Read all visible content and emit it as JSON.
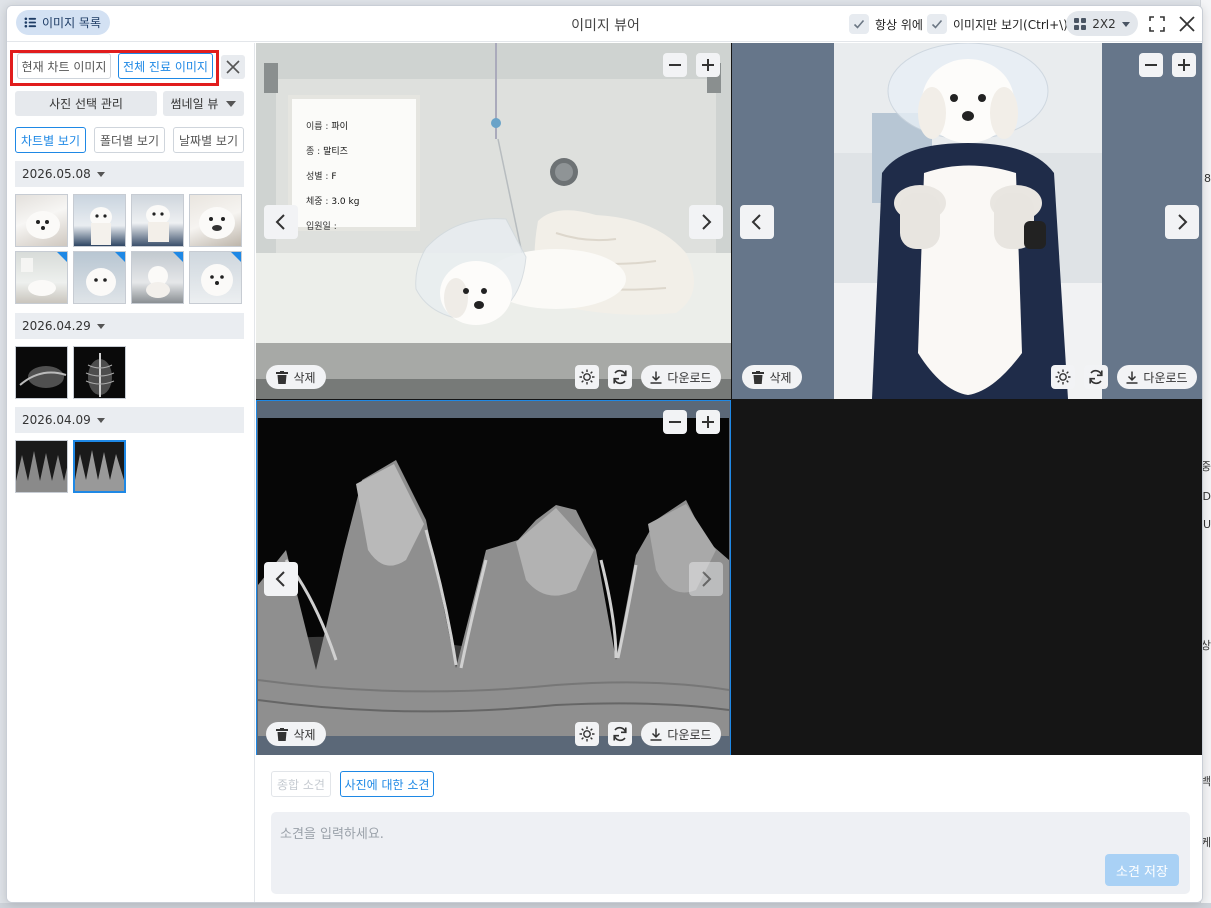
{
  "window": {
    "title": "이미지 뷰어",
    "image_list_button": "이미지 목록",
    "always_on_top": {
      "label": "항상 위에",
      "checked": true
    },
    "image_only": {
      "label": "이미지만 보기(Ctrl+\\)",
      "checked": true
    },
    "layout": "2X2"
  },
  "sidebar": {
    "scope_tabs": [
      {
        "label": "현재 차트 이미지",
        "active": false
      },
      {
        "label": "전체 진료 이미지",
        "active": true
      }
    ],
    "manage_button": "사진 선택 관리",
    "view_mode": "썸네일 뷰",
    "view_tabs": [
      {
        "label": "차트별 보기",
        "active": true
      },
      {
        "label": "폴더별 보기",
        "active": false
      },
      {
        "label": "날짜별 보기",
        "active": false
      }
    ],
    "groups": [
      {
        "date": "2026.05.08",
        "count": 8
      },
      {
        "date": "2026.04.29",
        "count": 2
      },
      {
        "date": "2026.04.09",
        "count": 2
      }
    ]
  },
  "card": {
    "name_label": "이름 :",
    "name": "파이",
    "breed_label": "종 :",
    "breed": "말티즈",
    "sex_label": "성별 :",
    "sex": "F",
    "weight_label": "체중 :",
    "weight": "3.0 kg",
    "admit_label": "입원일 :"
  },
  "viewer": {
    "delete_label": "삭제",
    "download_label": "다운로드"
  },
  "comments": {
    "tabs": [
      {
        "label": "종합 소견",
        "active": false
      },
      {
        "label": "사진에 대한 소견",
        "active": true
      }
    ],
    "placeholder": "소견을 입력하세요.",
    "save_label": "소견 저장"
  },
  "background_fragments": [
    "8",
    "중",
    "D",
    "U",
    "상",
    "백",
    "케"
  ],
  "colors": {
    "accent": "#1e88e5",
    "highlight": "#e11d1d",
    "viewer_bg": "#151515"
  }
}
